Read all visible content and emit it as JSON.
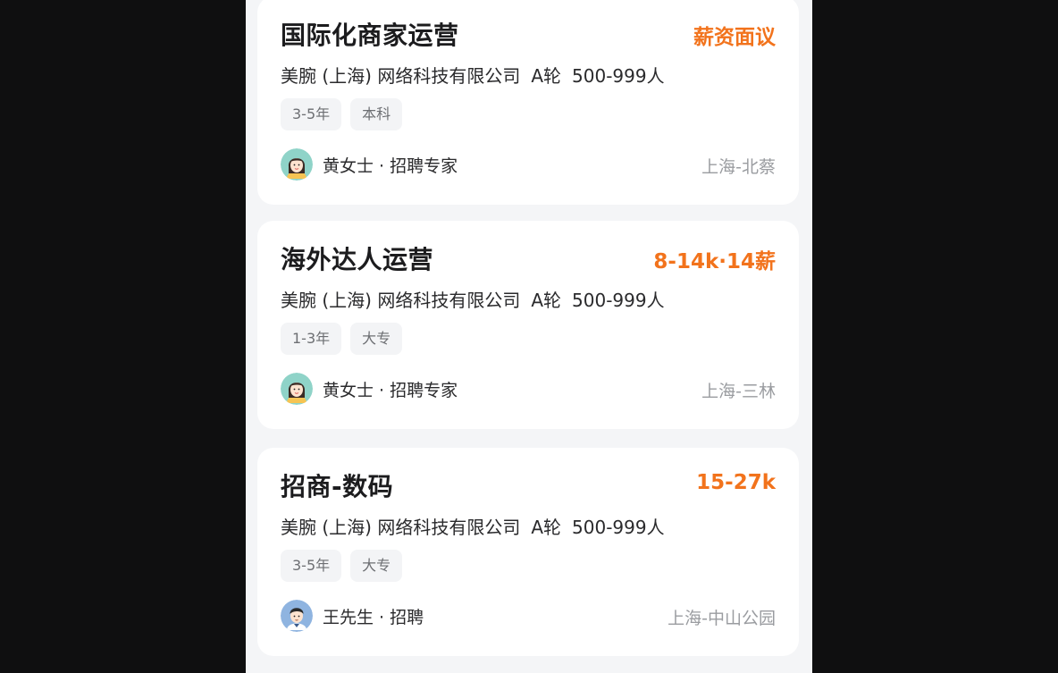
{
  "jobs": [
    {
      "title": "国际化商家运营",
      "salary": "薪资面议",
      "company": "美腕 (上海) 网络科技有限公司",
      "funding": "A轮",
      "size": "500-999人",
      "tags": [
        "3-5年",
        "本科"
      ],
      "recruiter": "黄女士 · 招聘专家",
      "location": "上海-北蔡",
      "avatar_icon": "female-avatar-icon"
    },
    {
      "title": "海外达人运营",
      "salary": "8-14k·14薪",
      "company": "美腕 (上海) 网络科技有限公司",
      "funding": "A轮",
      "size": "500-999人",
      "tags": [
        "1-3年",
        "大专"
      ],
      "recruiter": "黄女士 · 招聘专家",
      "location": "上海-三林",
      "avatar_icon": "female-avatar-icon"
    },
    {
      "title": "招商-数码",
      "salary": "15-27k",
      "company": "美腕 (上海) 网络科技有限公司",
      "funding": "A轮",
      "size": "500-999人",
      "tags": [
        "3-5年",
        "大专"
      ],
      "recruiter": "王先生 · 招聘",
      "location": "上海-中山公园",
      "avatar_icon": "male-avatar-icon"
    }
  ],
  "colors": {
    "salary": "#f2731c",
    "card_bg": "#ffffff",
    "page_bg": "#f4f5f7",
    "tag_bg": "#f3f4f6"
  }
}
